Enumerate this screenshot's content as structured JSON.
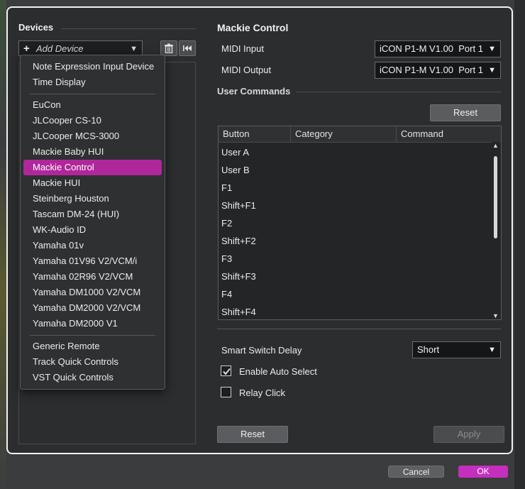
{
  "devices": {
    "heading": "Devices",
    "add_device_label": "Add Device",
    "menu_items": [
      {
        "label": "Note Expression Input Device",
        "selected": false
      },
      {
        "label": "Time Display",
        "selected": false
      },
      {
        "label": "EuCon",
        "selected": false
      },
      {
        "label": "JLCooper CS-10",
        "selected": false
      },
      {
        "label": "JLCooper MCS-3000",
        "selected": false
      },
      {
        "label": "Mackie Baby HUI",
        "selected": false
      },
      {
        "label": "Mackie Control",
        "selected": true
      },
      {
        "label": "Mackie HUI",
        "selected": false
      },
      {
        "label": "Steinberg Houston",
        "selected": false
      },
      {
        "label": "Tascam DM-24 (HUI)",
        "selected": false
      },
      {
        "label": "WK-Audio ID",
        "selected": false
      },
      {
        "label": "Yamaha 01v",
        "selected": false
      },
      {
        "label": "Yamaha 01V96 V2/VCM/i",
        "selected": false
      },
      {
        "label": "Yamaha 02R96 V2/VCM",
        "selected": false
      },
      {
        "label": "Yamaha DM1000 V2/VCM",
        "selected": false
      },
      {
        "label": "Yamaha DM2000 V2/VCM",
        "selected": false
      },
      {
        "label": "Yamaha DM2000 V1",
        "selected": false
      },
      {
        "label": "Generic Remote",
        "selected": false
      },
      {
        "label": "Track Quick Controls",
        "selected": false
      },
      {
        "label": "VST Quick Controls",
        "selected": false
      }
    ]
  },
  "device": {
    "title": "Mackie Control",
    "midi_input_label": "MIDI Input",
    "midi_input_value": "iCON P1-M V1.00  Port 1",
    "midi_output_label": "MIDI Output",
    "midi_output_value": "iCON P1-M V1.00  Port 1",
    "user_commands_label": "User Commands",
    "reset_label": "Reset",
    "table": {
      "columns": [
        "Button",
        "Category",
        "Command"
      ],
      "rows": [
        "User A",
        "User B",
        "F1",
        "Shift+F1",
        "F2",
        "Shift+F2",
        "F3",
        "Shift+F3",
        "F4",
        "Shift+F4"
      ]
    },
    "smart_switch_label": "Smart Switch Delay",
    "smart_switch_value": "Short",
    "enable_auto_select_label": "Enable Auto Select",
    "enable_auto_select_checked": true,
    "relay_click_label": "Relay Click",
    "relay_click_checked": false,
    "bottom_reset_label": "Reset",
    "apply_label": "Apply"
  },
  "footer": {
    "cancel_label": "Cancel",
    "ok_label": "OK"
  },
  "colors": {
    "accent": "#b0279b",
    "ok": "#c52fbd"
  }
}
